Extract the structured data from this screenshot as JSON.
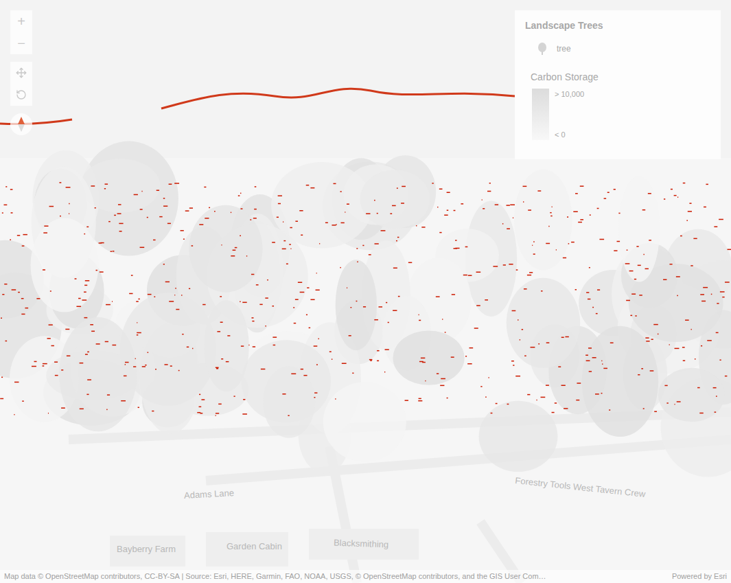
{
  "navigation": {
    "zoom_in": "+",
    "zoom_out": "−"
  },
  "legend": {
    "layer_title": "Landscape Trees",
    "symbol_label": "tree",
    "ramp_title": "Carbon Storage",
    "ramp_max": "> 10,000",
    "ramp_min": "< 0"
  },
  "map_labels": [
    "Adams Lane",
    "Garden Cabin",
    "Blacksmithing",
    "Bayberry Farm",
    "Forestry Tools West Tavern Crew"
  ],
  "attribution": {
    "text": "Map data © OpenStreetMap contributors, CC-BY-SA | Source: Esri, HERE, Garmin, FAO, NOAA, USGS, © OpenStreetMap contributors, and the GIS User Com…",
    "powered_by": "Powered by Esri"
  }
}
